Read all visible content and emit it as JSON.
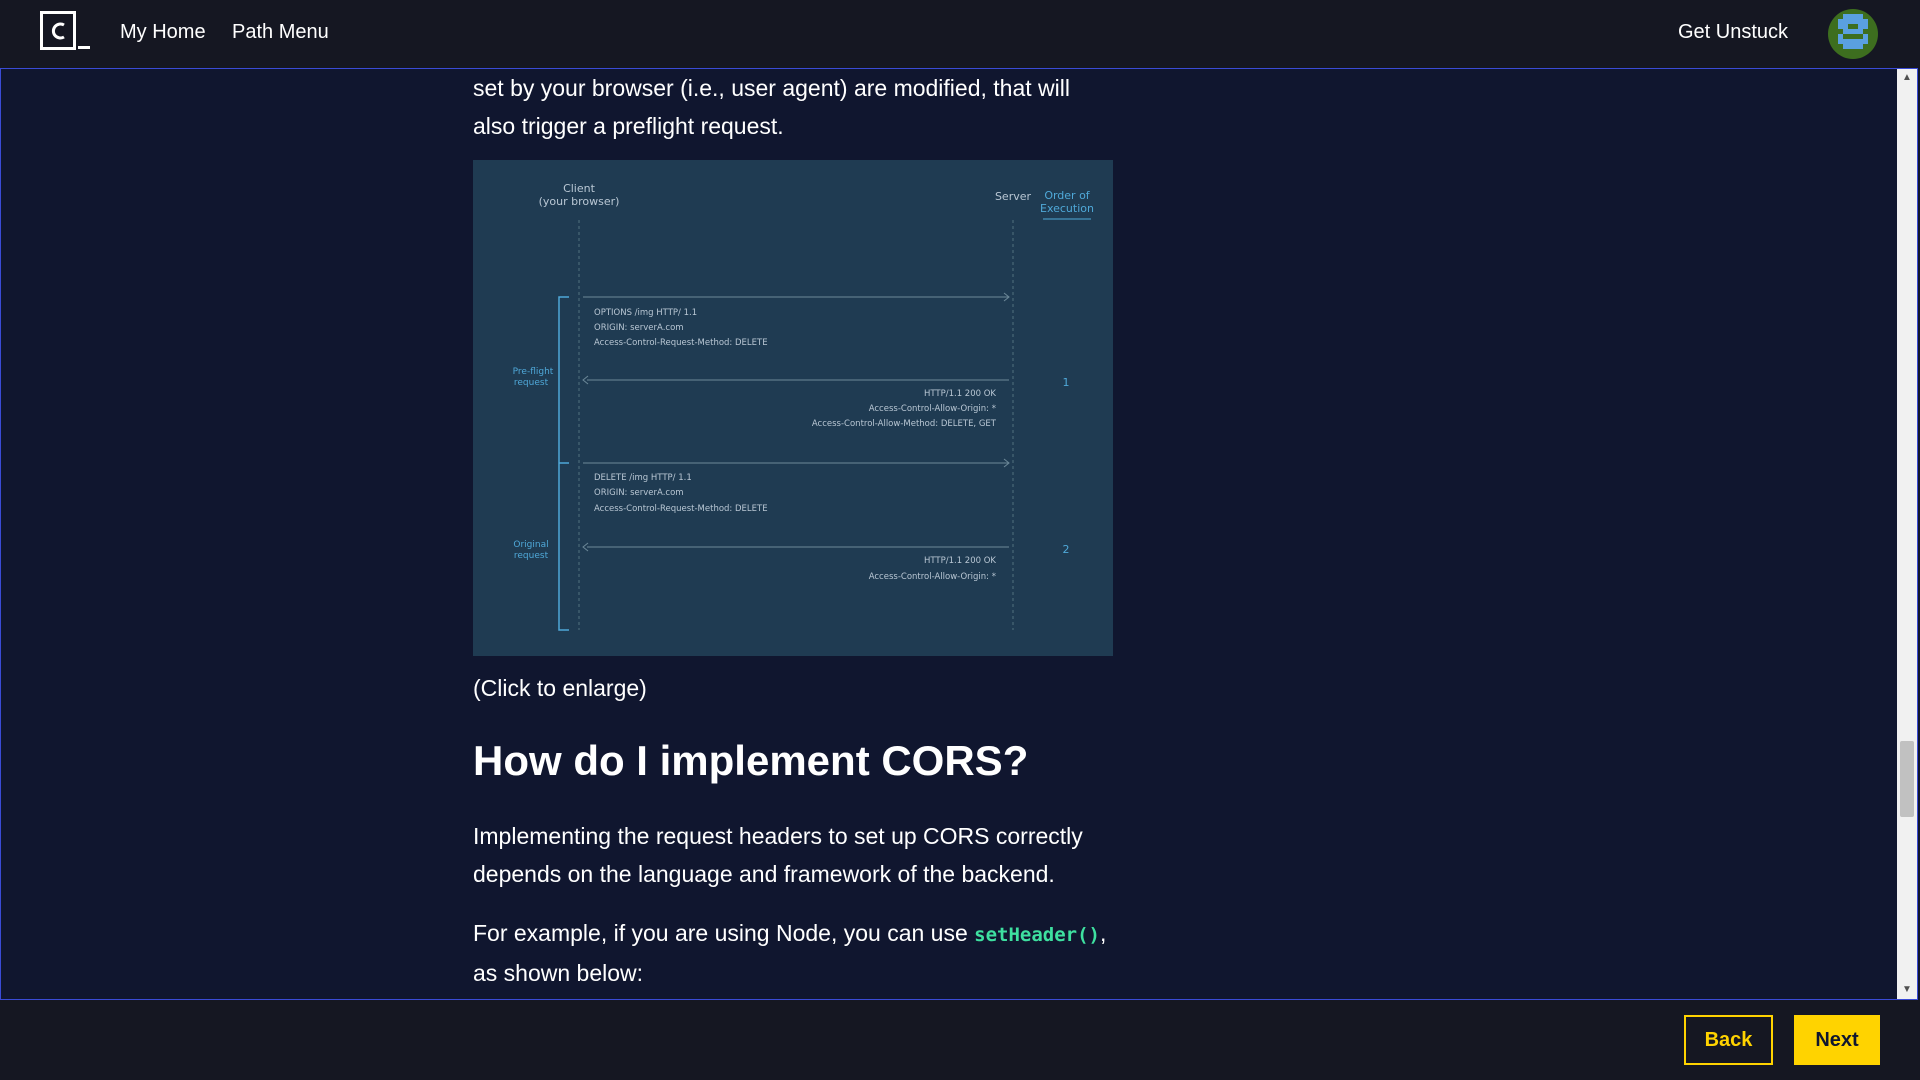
{
  "header": {
    "nav": {
      "home": "My Home",
      "path_menu": "Path Menu"
    },
    "get_unstuck": "Get Unstuck"
  },
  "article": {
    "intro_text": "set by your browser (i.e., user agent) are modified, that will also trigger a preflight request.",
    "caption": "(Click to enlarge)",
    "heading": "How do I implement CORS?",
    "implementing_text": "Implementing the request headers to set up CORS correctly depends on the language and framework of the backend.",
    "example_prefix": "For example, if you are using Node, you can use ",
    "example_code": "setHeader()",
    "example_suffix": ", as shown below:"
  },
  "diagram": {
    "client_label": "Client",
    "client_sub": "(your browser)",
    "server_label": "Server",
    "order_label_1": "Order of",
    "order_label_2": "Execution",
    "preflight_label_1": "Pre-flight",
    "preflight_label_2": "request",
    "original_label_1": "Original",
    "original_label_2": "request",
    "req1": [
      "OPTIONS  /img HTTP/ 1.1",
      "ORIGIN: serverA.com",
      "Access-Control-Request-Method: DELETE"
    ],
    "res1": [
      "HTTP/1.1  200 OK",
      "Access-Control-Allow-Origin: *",
      "Access-Control-Allow-Method: DELETE, GET"
    ],
    "req2": [
      "DELETE  /img HTTP/ 1.1",
      "ORIGIN: serverA.com",
      "Access-Control-Request-Method: DELETE"
    ],
    "res2": [
      "HTTP/1.1  200 OK",
      "Access-Control-Allow-Origin: *"
    ],
    "step1": "1",
    "step2": "2"
  },
  "footer": {
    "back": "Back",
    "next": "Next"
  },
  "colors": {
    "accent": "#ffd300",
    "code": "#3ee0a0",
    "background": "#10162f",
    "bar": "#151722",
    "diagram_bg": "#1f3b52"
  }
}
